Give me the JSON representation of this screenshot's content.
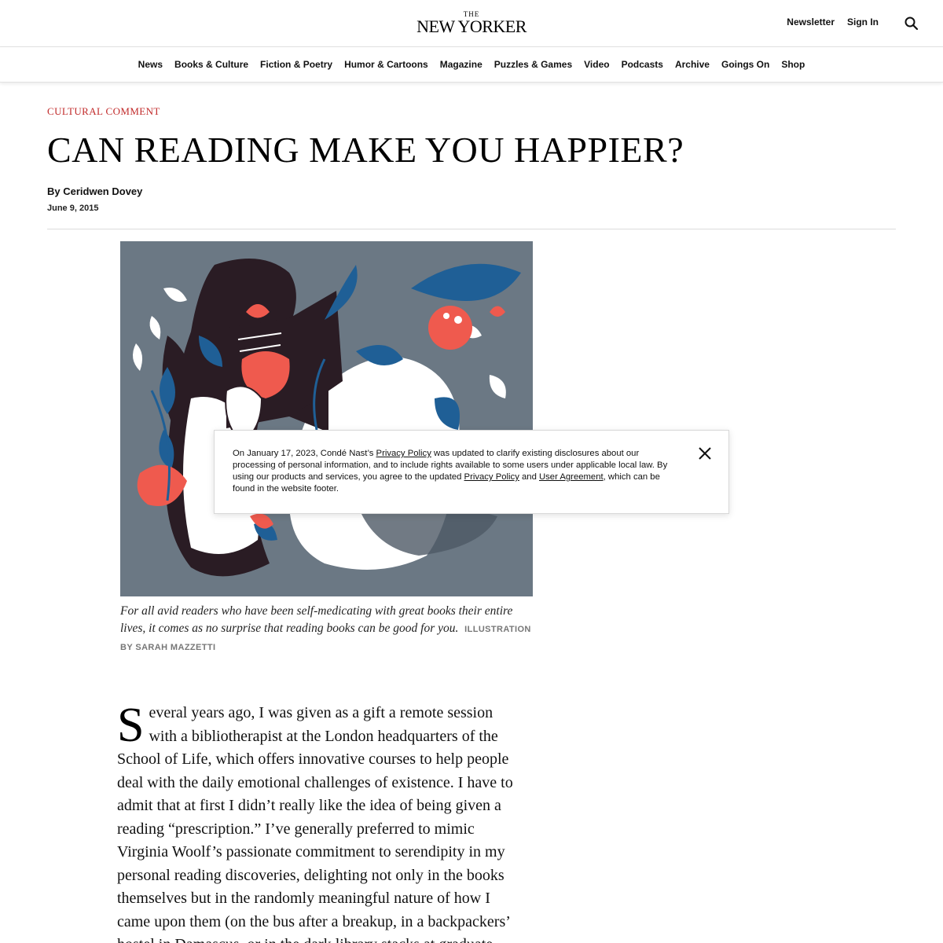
{
  "header": {
    "logo_the": "THE",
    "logo_main": "NEW YORKER",
    "newsletter": "Newsletter",
    "sign_in": "Sign In",
    "search_icon": "search-icon"
  },
  "nav": {
    "items": [
      "News",
      "Books & Culture",
      "Fiction & Poetry",
      "Humor & Cartoons",
      "Magazine",
      "Puzzles & Games",
      "Video",
      "Podcasts",
      "Archive",
      "Goings On",
      "Shop"
    ]
  },
  "article": {
    "rubric": "CULTURAL COMMENT",
    "headline": "CAN READING MAKE YOU HAPPIER?",
    "byline_prefix": "By ",
    "author": "Ceridwen Dovey",
    "date": "June 9, 2015",
    "caption": "For all avid readers who have been self-medicating with great books their entire lives, it comes as no surprise that reading books can be good for you.",
    "credit": "ILLUSTRATION BY SARAH MAZZETTI",
    "dropcap": "S",
    "body": "everal years ago, I was given as a gift a remote session with a bibliotherapist at the London headquarters of the School of Life, which offers innovative courses to help people deal with the daily emotional challenges of existence. I have to admit that at first I didn’t really like the idea of being given a reading “prescription.” I’ve generally preferred to mimic Virginia Woolf’s passionate commitment to serendipity in my personal reading discoveries, delighting not only in the books themselves but in the randomly meaningful nature of how I came upon them (on the bus after a breakup, in a backpackers’ hostel in Damascus, or in the dark library stacks at graduate school,"
  },
  "banner": {
    "text_1": "On January 17, 2023, Condé Nast’s ",
    "link_privacy_1": "Privacy Policy",
    "text_2": " was updated to clarify existing disclosures about our processing of personal information, and to include rights available to some users under applicable local law. By using our products and services, you agree to the updated ",
    "link_privacy_2": "Privacy Policy",
    "text_3": " and ",
    "link_user_agreement": "User Agreement",
    "text_4": ", which can be found in the website footer.",
    "close_icon": "close-icon"
  },
  "colors": {
    "rubric": "#c12a2a",
    "illustration_bg": "#6b7884",
    "illustration_blue": "#1f5f96",
    "illustration_red": "#ef5a4e",
    "illustration_dark": "#2a1c24"
  }
}
